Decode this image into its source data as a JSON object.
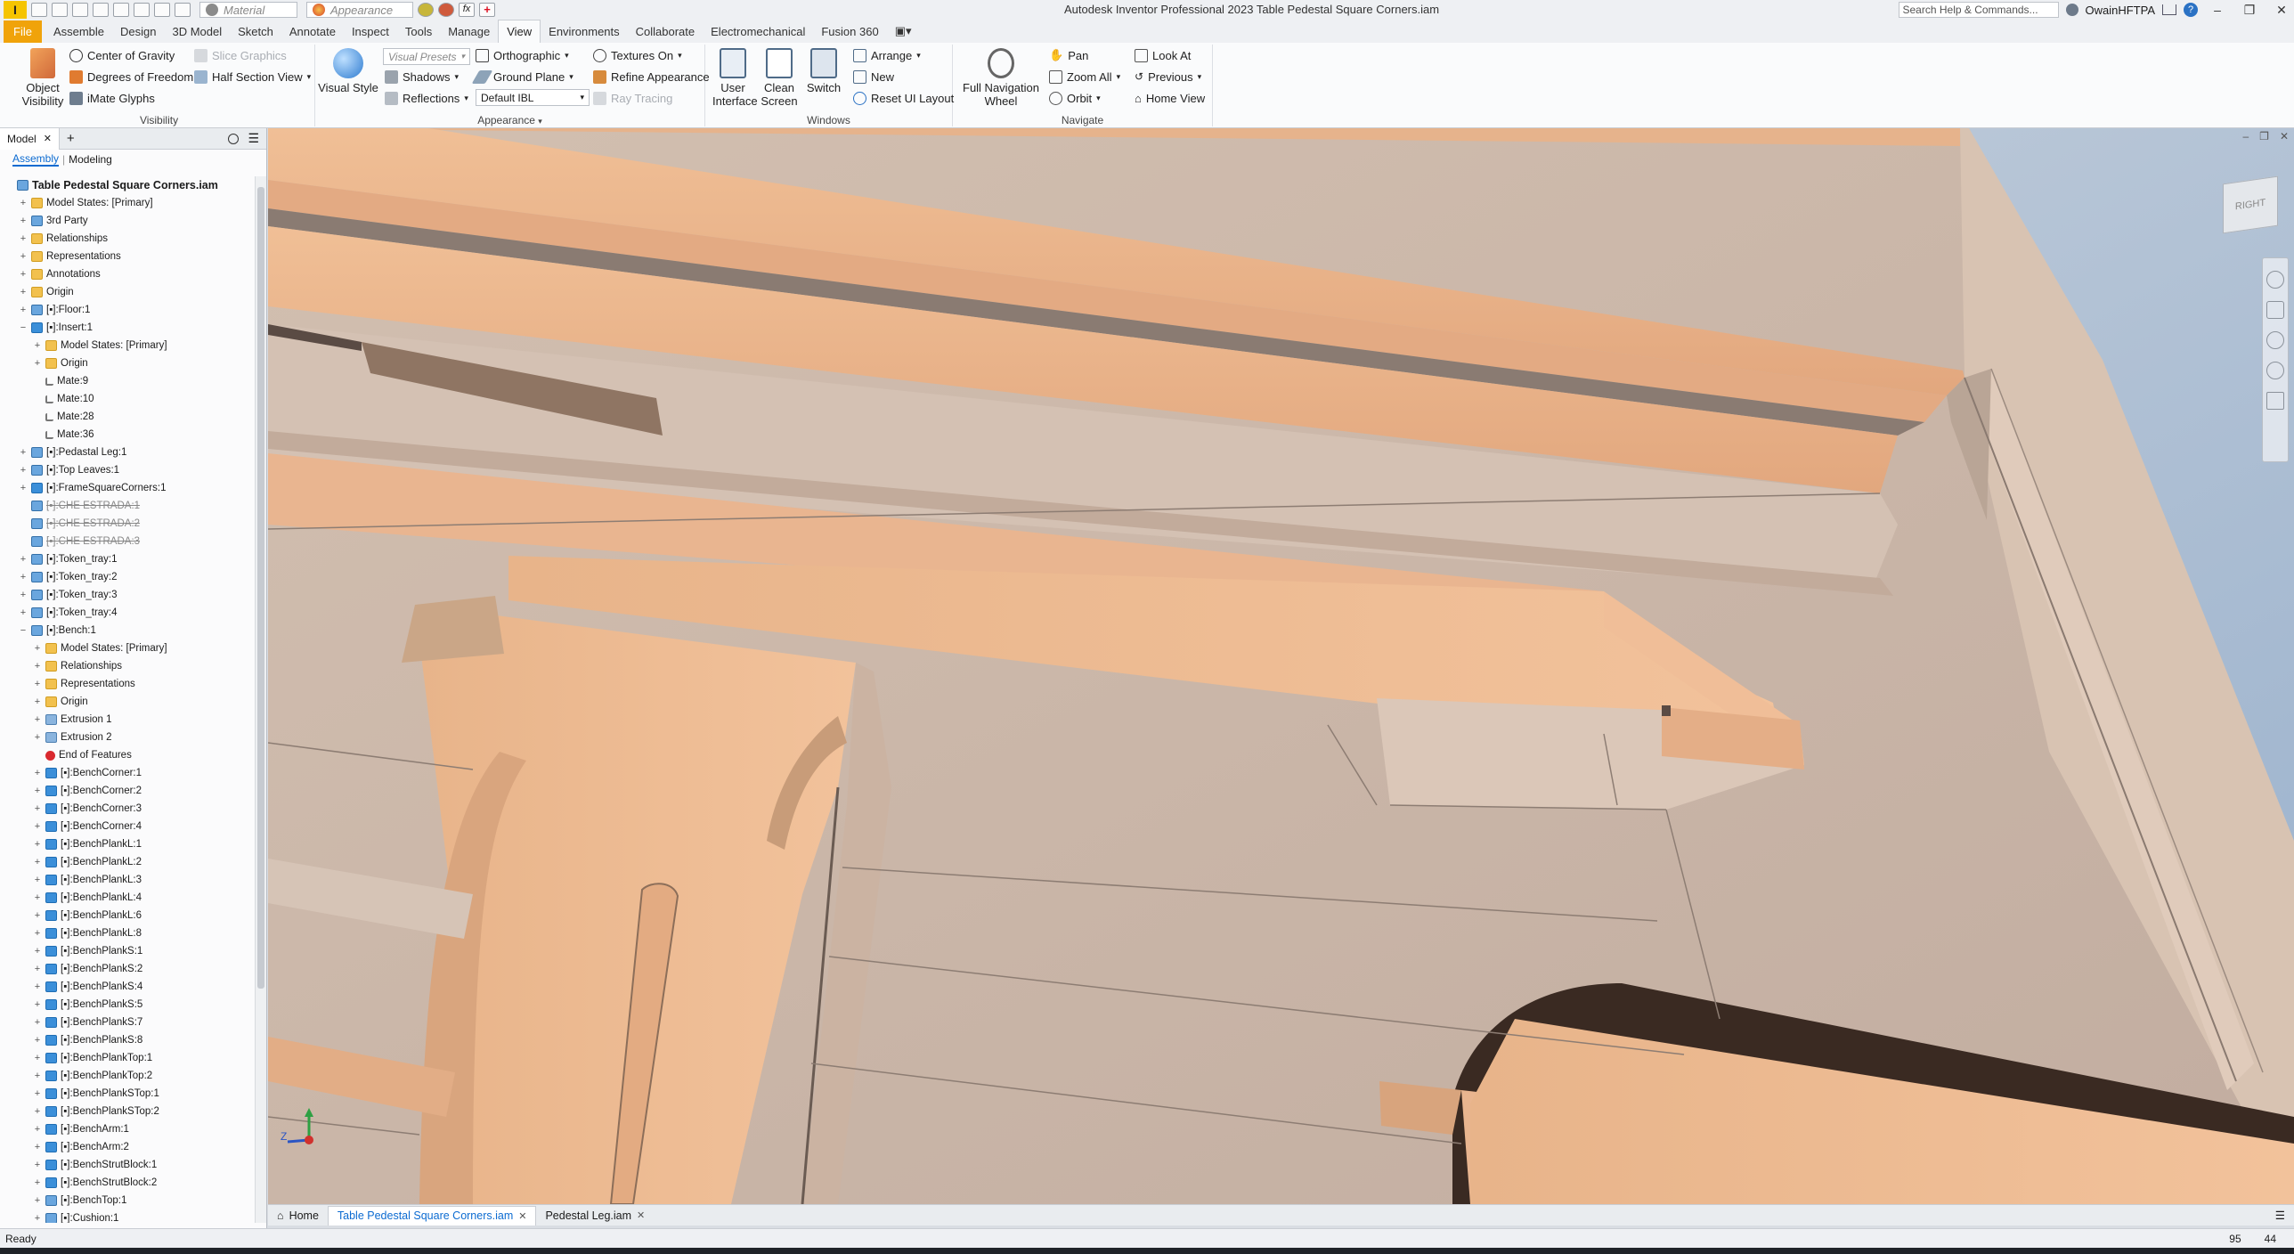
{
  "titlebar": {
    "logo": "I",
    "material_placeholder": "Material",
    "appearance_placeholder": "Appearance",
    "title": "Autodesk Inventor Professional 2023   Table Pedestal Square Corners.iam",
    "search_placeholder": "Search Help & Commands...",
    "user": "OwainHFTPA"
  },
  "ribbon_tabs": [
    "File",
    "Assemble",
    "Design",
    "3D Model",
    "Sketch",
    "Annotate",
    "Inspect",
    "Tools",
    "Manage",
    "View",
    "Environments",
    "Collaborate",
    "Electromechanical",
    "Fusion 360"
  ],
  "ribbon_active_tab": "View",
  "ribbon": {
    "visibility": {
      "label": "Visibility",
      "object_visibility": "Object\nVisibility",
      "center_of_gravity": "Center of Gravity",
      "degrees_of_freedom": "Degrees of Freedom",
      "imate_glyphs": "iMate Glyphs",
      "slice_graphics": "Slice Graphics",
      "half_section_view": "Half Section View"
    },
    "appearance": {
      "label": "Appearance",
      "visual_style": "Visual Style",
      "visual_presets": "Visual Presets",
      "shadows": "Shadows",
      "reflections": "Reflections",
      "orthographic": "Orthographic",
      "ground_plane": "Ground Plane",
      "default_ibl": "Default IBL",
      "textures_on": "Textures On",
      "refine_appearance": "Refine Appearance",
      "ray_tracing": "Ray Tracing"
    },
    "windows": {
      "label": "Windows",
      "user_interface": "User\nInterface",
      "clean_screen": "Clean\nScreen",
      "switch": "Switch",
      "arrange": "Arrange",
      "new": "New",
      "reset_ui_layout": "Reset UI Layout"
    },
    "navigate": {
      "label": "Navigate",
      "full_navigation_wheel": "Full Navigation\nWheel",
      "pan": "Pan",
      "zoom_all": "Zoom All",
      "orbit": "Orbit",
      "look_at": "Look At",
      "previous": "Previous",
      "home_view": "Home View"
    }
  },
  "browser": {
    "tab": "Model",
    "sub_tabs": [
      "Assembly",
      "Modeling"
    ],
    "tree": [
      {
        "label": "Table Pedestal Square Corners.iam",
        "level": 0,
        "icon": "asm",
        "root": true
      },
      {
        "label": "Model States: [Primary]",
        "level": 1,
        "icon": "folder",
        "exp": "+"
      },
      {
        "label": "3rd Party",
        "level": 1,
        "icon": "asm",
        "exp": "+"
      },
      {
        "label": "Relationships",
        "level": 1,
        "icon": "folder",
        "exp": "+"
      },
      {
        "label": "Representations",
        "level": 1,
        "icon": "folder",
        "exp": "+"
      },
      {
        "label": "Annotations",
        "level": 1,
        "icon": "folder",
        "exp": "+"
      },
      {
        "label": "Origin",
        "level": 1,
        "icon": "folder",
        "exp": "+"
      },
      {
        "label": "[▪]:Floor:1",
        "level": 1,
        "icon": "asm",
        "exp": "+"
      },
      {
        "label": "[▪]:Insert:1",
        "level": 1,
        "icon": "part",
        "exp": "−"
      },
      {
        "label": "Model States: [Primary]",
        "level": 2,
        "icon": "folder",
        "exp": "+"
      },
      {
        "label": "Origin",
        "level": 2,
        "icon": "folder",
        "exp": "+"
      },
      {
        "label": "Mate:9",
        "level": 2,
        "icon": "mate"
      },
      {
        "label": "Mate:10",
        "level": 2,
        "icon": "mate"
      },
      {
        "label": "Mate:28",
        "level": 2,
        "icon": "mate"
      },
      {
        "label": "Mate:36",
        "level": 2,
        "icon": "mate"
      },
      {
        "label": "[▪]:Pedastal Leg:1",
        "level": 1,
        "icon": "asm",
        "exp": "+"
      },
      {
        "label": "[▪]:Top Leaves:1",
        "level": 1,
        "icon": "asm",
        "exp": "+"
      },
      {
        "label": "[▪]:FrameSquareCorners:1",
        "level": 1,
        "icon": "part",
        "exp": "+"
      },
      {
        "label": "[▪]:CHE ESTRADA:1",
        "level": 1,
        "icon": "asm",
        "strike": true
      },
      {
        "label": "[▪]:CHE ESTRADA:2",
        "level": 1,
        "icon": "asm",
        "strike": true
      },
      {
        "label": "[▪]:CHE ESTRADA:3",
        "level": 1,
        "icon": "asm",
        "strike": true
      },
      {
        "label": "[▪]:Token_tray:1",
        "level": 1,
        "icon": "asm",
        "exp": "+"
      },
      {
        "label": "[▪]:Token_tray:2",
        "level": 1,
        "icon": "asm",
        "exp": "+"
      },
      {
        "label": "[▪]:Token_tray:3",
        "level": 1,
        "icon": "asm",
        "exp": "+"
      },
      {
        "label": "[▪]:Token_tray:4",
        "level": 1,
        "icon": "asm",
        "exp": "+"
      },
      {
        "label": "[▪]:Bench:1",
        "level": 1,
        "icon": "asm",
        "exp": "−"
      },
      {
        "label": "Model States: [Primary]",
        "level": 2,
        "icon": "folder",
        "exp": "+"
      },
      {
        "label": "Relationships",
        "level": 2,
        "icon": "folder",
        "exp": "+"
      },
      {
        "label": "Representations",
        "level": 2,
        "icon": "folder",
        "exp": "+"
      },
      {
        "label": "Origin",
        "level": 2,
        "icon": "folder",
        "exp": "+"
      },
      {
        "label": "Extrusion 1",
        "level": 2,
        "icon": "feat",
        "exp": "+"
      },
      {
        "label": "Extrusion 2",
        "level": 2,
        "icon": "feat",
        "exp": "+"
      },
      {
        "label": "End of Features",
        "level": 2,
        "icon": "error"
      },
      {
        "label": "[▪]:BenchCorner:1",
        "level": 2,
        "icon": "part",
        "exp": "+"
      },
      {
        "label": "[▪]:BenchCorner:2",
        "level": 2,
        "icon": "part",
        "exp": "+"
      },
      {
        "label": "[▪]:BenchCorner:3",
        "level": 2,
        "icon": "part",
        "exp": "+"
      },
      {
        "label": "[▪]:BenchCorner:4",
        "level": 2,
        "icon": "part",
        "exp": "+"
      },
      {
        "label": "[▪]:BenchPlankL:1",
        "level": 2,
        "icon": "part",
        "exp": "+"
      },
      {
        "label": "[▪]:BenchPlankL:2",
        "level": 2,
        "icon": "part",
        "exp": "+"
      },
      {
        "label": "[▪]:BenchPlankL:3",
        "level": 2,
        "icon": "part",
        "exp": "+"
      },
      {
        "label": "[▪]:BenchPlankL:4",
        "level": 2,
        "icon": "part",
        "exp": "+"
      },
      {
        "label": "[▪]:BenchPlankL:6",
        "level": 2,
        "icon": "part",
        "exp": "+"
      },
      {
        "label": "[▪]:BenchPlankL:8",
        "level": 2,
        "icon": "part",
        "exp": "+"
      },
      {
        "label": "[▪]:BenchPlankS:1",
        "level": 2,
        "icon": "part",
        "exp": "+"
      },
      {
        "label": "[▪]:BenchPlankS:2",
        "level": 2,
        "icon": "part",
        "exp": "+"
      },
      {
        "label": "[▪]:BenchPlankS:4",
        "level": 2,
        "icon": "part",
        "exp": "+"
      },
      {
        "label": "[▪]:BenchPlankS:5",
        "level": 2,
        "icon": "part",
        "exp": "+"
      },
      {
        "label": "[▪]:BenchPlankS:7",
        "level": 2,
        "icon": "part",
        "exp": "+"
      },
      {
        "label": "[▪]:BenchPlankS:8",
        "level": 2,
        "icon": "part",
        "exp": "+"
      },
      {
        "label": "[▪]:BenchPlankTop:1",
        "level": 2,
        "icon": "part",
        "exp": "+"
      },
      {
        "label": "[▪]:BenchPlankTop:2",
        "level": 2,
        "icon": "part",
        "exp": "+"
      },
      {
        "label": "[▪]:BenchPlankSTop:1",
        "level": 2,
        "icon": "part",
        "exp": "+"
      },
      {
        "label": "[▪]:BenchPlankSTop:2",
        "level": 2,
        "icon": "part",
        "exp": "+"
      },
      {
        "label": "[▪]:BenchArm:1",
        "level": 2,
        "icon": "part",
        "exp": "+"
      },
      {
        "label": "[▪]:BenchArm:2",
        "level": 2,
        "icon": "part",
        "exp": "+"
      },
      {
        "label": "[▪]:BenchStrutBlock:1",
        "level": 2,
        "icon": "part",
        "exp": "+"
      },
      {
        "label": "[▪]:BenchStrutBlock:2",
        "level": 2,
        "icon": "part",
        "exp": "+"
      },
      {
        "label": "[▪]:BenchTop:1",
        "level": 2,
        "icon": "asm",
        "exp": "+"
      },
      {
        "label": "[▪]:Cushion:1",
        "level": 2,
        "icon": "asm",
        "exp": "+"
      }
    ]
  },
  "viewport": {
    "viewcube_label": "RIGHT",
    "triad_z": "Z"
  },
  "doc_tabs": [
    {
      "label": "Home",
      "active": false,
      "closable": false
    },
    {
      "label": "Table Pedestal Square Corners.iam",
      "active": true,
      "closable": true
    },
    {
      "label": "Pedestal Leg.iam",
      "active": false,
      "closable": true
    }
  ],
  "status": {
    "text": "Ready",
    "num_a": "95",
    "num_b": "44"
  },
  "colors": {
    "accent": "#0c6bd1",
    "file_tab": "#f0a30a",
    "wood": "#e9b48b",
    "cushion": "#3a2a22"
  }
}
